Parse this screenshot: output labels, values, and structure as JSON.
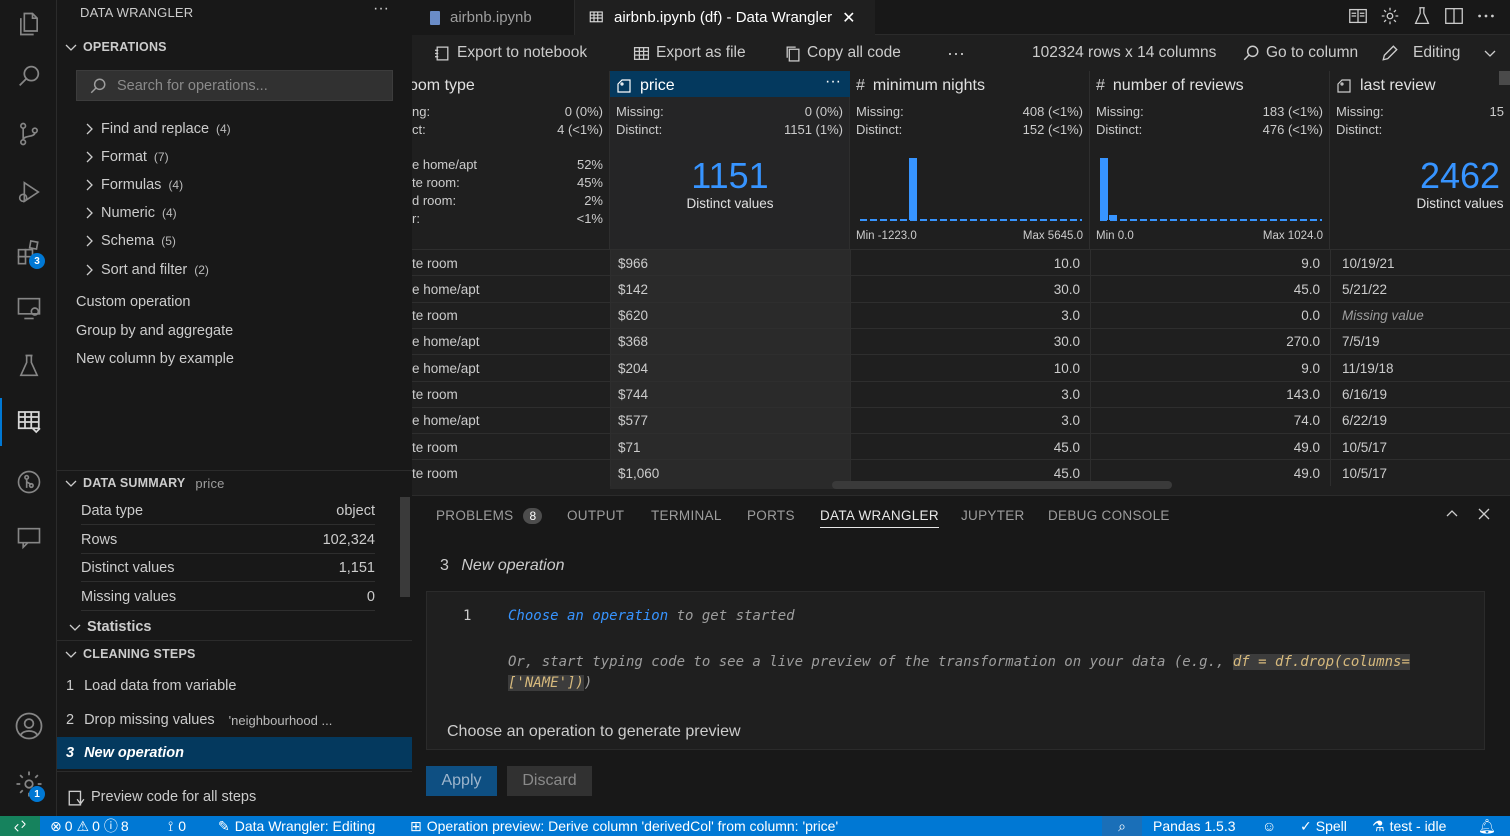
{
  "colors": {
    "accent": "#0078d4",
    "link": "#3794ff",
    "selected": "#04395e"
  },
  "activity": {
    "extensions_badge": "3",
    "accounts_badge": "1"
  },
  "sidebar": {
    "title": "DATA WRANGLER",
    "operations_header": "OPERATIONS",
    "search_placeholder": "Search for operations...",
    "groups": [
      {
        "label": "Find and replace",
        "count": "(4)"
      },
      {
        "label": "Format",
        "count": "(7)"
      },
      {
        "label": "Formulas",
        "count": "(4)"
      },
      {
        "label": "Numeric",
        "count": "(4)"
      },
      {
        "label": "Schema",
        "count": "(5)"
      },
      {
        "label": "Sort and filter",
        "count": "(2)"
      }
    ],
    "custom": [
      "Custom operation",
      "Group by and aggregate",
      "New column by example"
    ],
    "summary_header": "DATA SUMMARY",
    "summary_column": "price",
    "summary": [
      {
        "label": "Data type",
        "value": "object"
      },
      {
        "label": "Rows",
        "value": "102,324"
      },
      {
        "label": "Distinct values",
        "value": "1,151"
      },
      {
        "label": "Missing values",
        "value": "0"
      }
    ],
    "statistics": "Statistics",
    "steps_header": "CLEANING STEPS",
    "steps": [
      {
        "num": "1",
        "label": "Load data from variable",
        "extra": ""
      },
      {
        "num": "2",
        "label": "Drop missing values",
        "extra": "'neighbourhood ..."
      },
      {
        "num": "3",
        "label": "New operation",
        "extra": ""
      }
    ],
    "preview_code": "Preview code for all steps"
  },
  "tabs": [
    {
      "label": "airbnb.ipynb"
    },
    {
      "label": "airbnb.ipynb (df) - Data Wrangler"
    }
  ],
  "toolbar": {
    "export_notebook": "Export to notebook",
    "export_file": "Export as file",
    "copy_code": "Copy all code",
    "more": "···",
    "shape": "102324 rows x 14 columns",
    "goto": "Go to column",
    "mode": "Editing"
  },
  "columns": {
    "room": {
      "title": "oom type",
      "missing_label": "ng:",
      "missing": "0 (0%)",
      "distinct_label": "ct:",
      "distinct": "4 (<1%)",
      "breakdown": [
        {
          "label": "e home/apt",
          "value": "52%"
        },
        {
          "label": "te room:",
          "value": "45%"
        },
        {
          "label": "d room:",
          "value": "2%"
        },
        {
          "label": "r:",
          "value": "<1%"
        }
      ]
    },
    "price": {
      "title": "price",
      "missing_label": "Missing:",
      "missing": "0 (0%)",
      "distinct_label": "Distinct:",
      "distinct": "1151 (1%)",
      "big": "1151",
      "big_label": "Distinct values"
    },
    "minnights": {
      "title": "minimum nights",
      "missing_label": "Missing:",
      "missing": "408 (<1%)",
      "distinct_label": "Distinct:",
      "distinct": "152 (<1%)",
      "min": "Min -1223.0",
      "max": "Max 5645.0"
    },
    "reviews": {
      "title": "number of reviews",
      "missing_label": "Missing:",
      "missing": "183 (<1%)",
      "distinct_label": "Distinct:",
      "distinct": "476 (<1%)",
      "min": "Min 0.0",
      "max": "Max 1024.0"
    },
    "lastreview": {
      "title": "last review",
      "missing_label": "Missing:",
      "missing": "15",
      "distinct_label": "Distinct:",
      "big": "2462",
      "big_label": "Distinct values"
    }
  },
  "rows": [
    {
      "room": "te room",
      "price": "$966",
      "nights": "10.0",
      "reviews": "9.0",
      "last": "10/19/21"
    },
    {
      "room": "e home/apt",
      "price": "$142",
      "nights": "30.0",
      "reviews": "45.0",
      "last": "5/21/22"
    },
    {
      "room": "te room",
      "price": "$620",
      "nights": "3.0",
      "reviews": "0.0",
      "last": "Missing value"
    },
    {
      "room": "e home/apt",
      "price": "$368",
      "nights": "30.0",
      "reviews": "270.0",
      "last": "7/5/19"
    },
    {
      "room": "e home/apt",
      "price": "$204",
      "nights": "10.0",
      "reviews": "9.0",
      "last": "11/19/18"
    },
    {
      "room": "te room",
      "price": "$744",
      "nights": "3.0",
      "reviews": "143.0",
      "last": "6/16/19"
    },
    {
      "room": "e home/apt",
      "price": "$577",
      "nights": "3.0",
      "reviews": "74.0",
      "last": "6/22/19"
    },
    {
      "room": "te room",
      "price": "$71",
      "nights": "45.0",
      "reviews": "49.0",
      "last": "10/5/17"
    },
    {
      "room": "te room",
      "price": "$1,060",
      "nights": "45.0",
      "reviews": "49.0",
      "last": "10/5/17"
    }
  ],
  "panel": {
    "tabs": [
      "PROBLEMS",
      "OUTPUT",
      "TERMINAL",
      "PORTS",
      "DATA WRANGLER",
      "JUPYTER",
      "DEBUG CONSOLE"
    ],
    "problems_count": "8",
    "step_num": "3",
    "step_title": "New operation",
    "line_num": "1",
    "choose_link": "Choose an operation",
    "choose_rest": " to get started",
    "or_text": "Or, start typing code to see a live preview of the transformation on your data (e.g., ",
    "code_example_1": "df = df.drop(columns=",
    "code_example_2": "['NAME'])",
    "close_paren": ")",
    "preview_msg": "Choose an operation to generate preview",
    "apply": "Apply",
    "discard": "Discard"
  },
  "status": {
    "remote": "",
    "errors": "0",
    "warnings": "0",
    "info": "0",
    "info2": "8",
    "ports": "0",
    "wrangler": "Data Wrangler: Editing",
    "preview": "Operation preview: Derive column 'derivedCol' from column: 'price'",
    "pandas": "Pandas 1.5.3",
    "spell": "Spell",
    "kernel": "test - idle"
  }
}
